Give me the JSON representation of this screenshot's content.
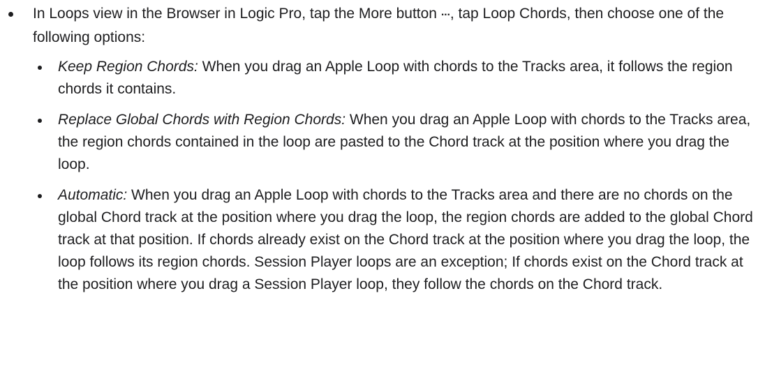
{
  "intro": {
    "part1": "In Loops view in the Browser in Logic Pro, tap the More button ",
    "more_glyph": "···",
    "part2": ", tap Loop Chords, then choose one of the following options:"
  },
  "options": [
    {
      "term": "Keep Region Chords:",
      "description": " When you drag an Apple Loop with chords to the Tracks area, it follows the region chords it contains."
    },
    {
      "term": "Replace Global Chords with Region Chords:",
      "description": " When you drag an Apple Loop with chords to the Tracks area, the region chords contained in the loop are pasted to the Chord track at the position where you drag the loop."
    },
    {
      "term": "Automatic:",
      "description": " When you drag an Apple Loop with chords to the Tracks area and there are no chords on the global Chord track at the position where you drag the loop, the region chords are added to the global Chord track at that position. If chords already exist on the Chord track at the position where you drag the loop, the loop follows its region chords. Session Player loops are an exception; If chords exist on the Chord track at the position where you drag a Session Player loop, they follow the chords on the Chord track."
    }
  ]
}
